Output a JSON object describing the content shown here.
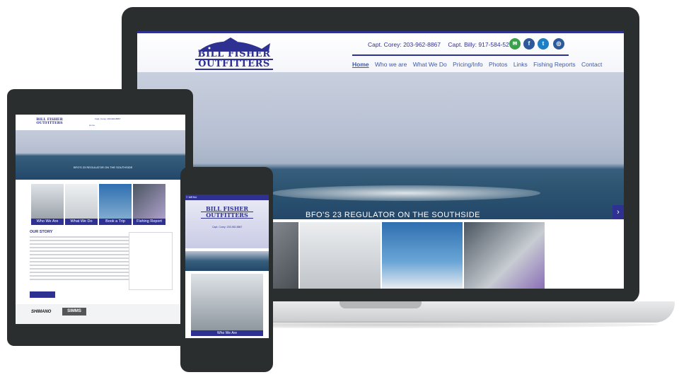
{
  "site": {
    "logo_line1": "BILL FISHER",
    "logo_line2": "OUTFITTERS",
    "contact_corey": "Capt. Corey: 203-962-8867",
    "contact_billy": "Capt. Billy: 917-584-5270",
    "social": [
      {
        "icon": "email-icon",
        "glyph": "✉",
        "color": "#3aa14a"
      },
      {
        "icon": "facebook-icon",
        "glyph": "f",
        "color": "#2e5a9b"
      },
      {
        "icon": "twitter-icon",
        "glyph": "t",
        "color": "#1e7fc4"
      },
      {
        "icon": "instagram-icon",
        "glyph": "◎",
        "color": "#2e5a9b"
      }
    ],
    "nav": [
      "Home",
      "Who we are",
      "What We Do",
      "Pricing/Info",
      "Photos",
      "Links",
      "Fishing Reports",
      "Contact"
    ],
    "hero_caption": "BFO'S 23 REGULATOR ON THE SOUTHSIDE",
    "hero_next_glyph": "›",
    "brand_color": "#2f3192"
  },
  "tablet": {
    "tiles": [
      "Who We Are",
      "What We Do",
      "Book a Trip",
      "Fishing Report"
    ],
    "story_heading": "OUR STORY",
    "brands": [
      "SHIMANO",
      "SIMMS"
    ]
  },
  "phone": {
    "menu_label": "MENU",
    "tile_label": "Who We Are"
  }
}
